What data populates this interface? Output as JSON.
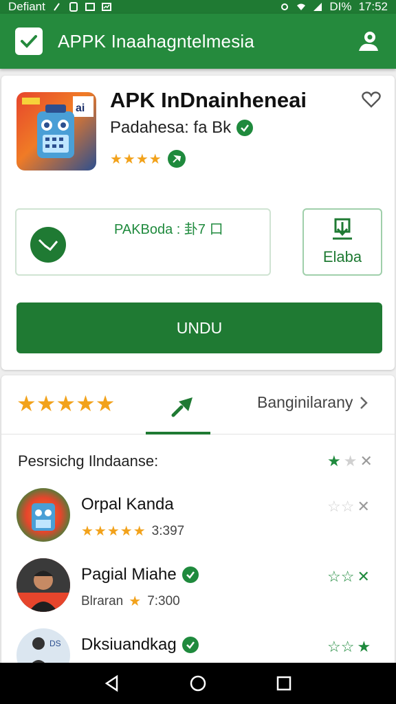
{
  "status_bar": {
    "carrier": "Defiant",
    "battery": "DI%",
    "time": "17:52"
  },
  "app_bar": {
    "title": "APPK Inaahagntelmesia",
    "check_icon": "check-icon",
    "profile_icon": "profile-icon"
  },
  "app": {
    "name": "APK InDnainheneai",
    "developer": "Padahesa: fa Bk",
    "rating_stars": "★★★★",
    "info_text": "PAKBoda : 卦7 口",
    "flag_label": "Elaba",
    "download_label": "UNDU"
  },
  "tabs": {
    "rating_stars": "★★★★★",
    "right_label": "Banginilarany"
  },
  "list": {
    "heading": "Pesrsichg Ilndaanse:",
    "items": [
      {
        "name": "Orpal Kanda",
        "stars": "★★★★★",
        "meta": "3:397",
        "verified": false
      },
      {
        "name": "Pagial Miahe",
        "stars": "★",
        "meta_prefix": "Blraran",
        "meta": "7:300",
        "verified": true
      },
      {
        "name": "Dksiuandkag",
        "stars": "",
        "meta": "",
        "verified": true
      }
    ]
  },
  "colors": {
    "primary": "#258a3d",
    "dark_primary": "#1f7a33",
    "star": "#f2a21b"
  }
}
